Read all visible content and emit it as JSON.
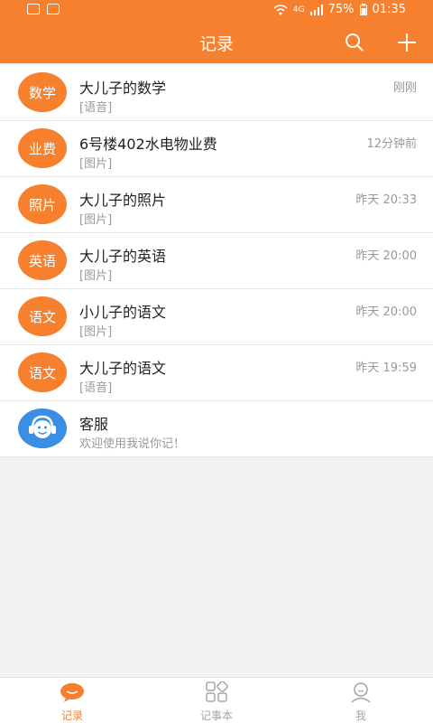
{
  "status": {
    "battery_text": "75%",
    "time": "01:35",
    "network": "4G"
  },
  "header": {
    "title": "记录"
  },
  "records": [
    {
      "avatar": "数学",
      "title": "大儿子的数学",
      "sub": "[语音]",
      "time": "刚刚"
    },
    {
      "avatar": "业费",
      "title": "6号楼402水电物业费",
      "sub": "[图片]",
      "time": "12分钟前"
    },
    {
      "avatar": "照片",
      "title": "大儿子的照片",
      "sub": "[图片]",
      "time": "昨天 20:33"
    },
    {
      "avatar": "英语",
      "title": "大儿子的英语",
      "sub": "[图片]",
      "time": "昨天 20:00"
    },
    {
      "avatar": "语文",
      "title": "小儿子的语文",
      "sub": "[图片]",
      "time": "昨天 20:00"
    },
    {
      "avatar": "语文",
      "title": "大儿子的语文",
      "sub": "[语音]",
      "time": "昨天 19:59"
    }
  ],
  "service": {
    "title": "客服",
    "sub": "欢迎使用我说你记！"
  },
  "tabs": [
    {
      "label": "记录"
    },
    {
      "label": "记事本"
    },
    {
      "label": "我"
    }
  ],
  "colors": {
    "accent": "#f7802e",
    "service_blue": "#3b8ee4"
  }
}
